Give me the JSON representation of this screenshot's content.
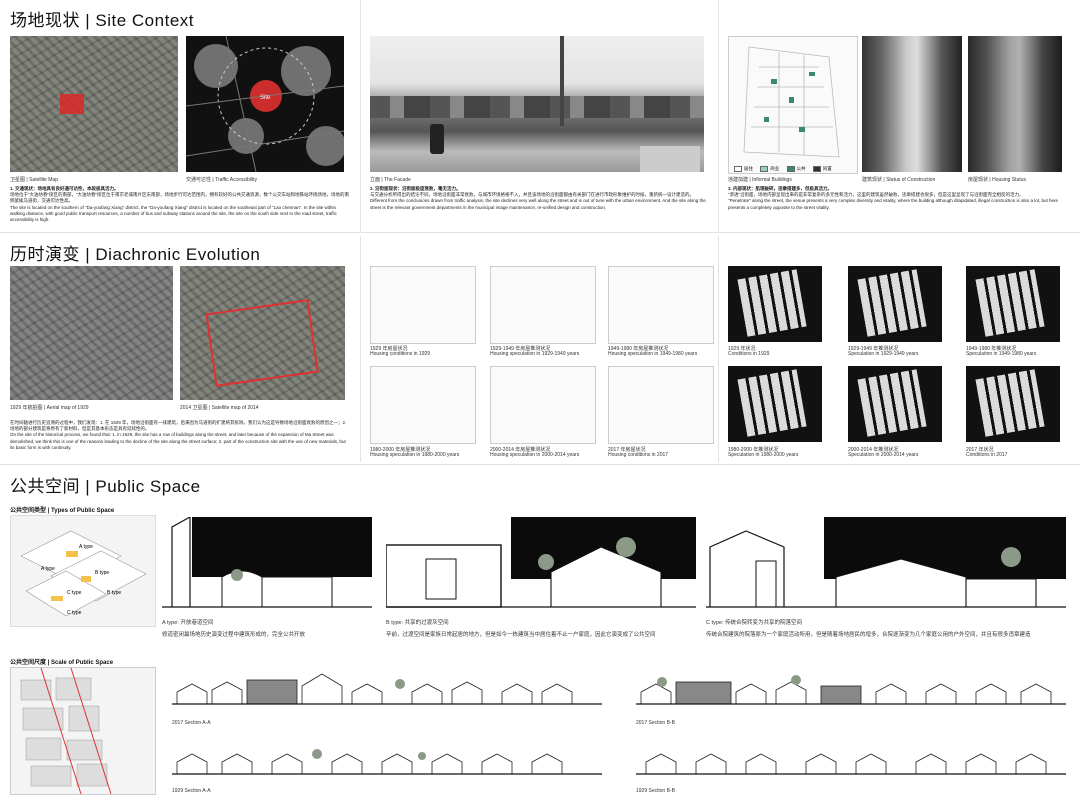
{
  "sections": {
    "site_context": {
      "cn": "场地现状",
      "sep": "|",
      "en": "Site Context"
    },
    "diachronic": {
      "cn": "历时演变",
      "sep": "|",
      "en": "Diachronic Evolution"
    },
    "public_space": {
      "cn": "公共空间",
      "sep": "|",
      "en": "Public Space"
    }
  },
  "site": {
    "cap_satellite": "卫星图 | Satellite Map",
    "cap_traffic": "交通可达性 | Traffic Accessibility",
    "site_label": "Site",
    "p1_title": "1. 交通现状：场地具有良好通可达性，本段极具活力。",
    "p1_cn": "场地位于“大油坊巷”街区的南部，“大油坊巷”街区位于南京老城南片区东南部，场地步行可达范围内，拥有较好的公共交通资源，数个公交车站和地铁站环绕场地，场地的南侧紧挨马道街，交通可达性高。",
    "p1_en": "The site is located on the southern of \"Da-youfang Xiang\" district, the \"Da-youfang Xiang\" district is located on the southeast part of \"Lao chennan\". In the site within walking distance, with good public transport resources, a number of bus and subway stations around the site, the site on the south side next to the road street, traffic accessibility is high.",
    "cap_facade": "立面 | The Facade",
    "p2_title": "2. 沿街面现状：沿街面极度衰败，毫无活力。",
    "p2_cn": "与交通分析所得出的结论不同，场地沿街面非常衰败，与城市环境格格不入。并且该场地的沿街面都由有关部门在进行市政形象维护的时候，重新统一设计建造的。",
    "p2_en": "Different from the conclusions drawn from traffic analysis, the site declines very well along the street and is out of tune with the urban environment. And the site along the street is the relevant government departments in the municipal image maintenance, re-unified design and construction.",
    "legend": [
      "居住",
      "商业",
      "公共",
      "闲置"
    ],
    "cap_informal": "违建加建 | Informal Buildings",
    "cap_construction": "建筑现状 | Status of Construction",
    "cap_housing": "房屋现状 | Housing Status",
    "p3_title": "3. 内部现状：肌理破碎，违章搭建多，但极具活力。",
    "p3_cn": "“渗透”沿街面，场地内部呈现出来的是非常复杂的多元性和活力，这里的建筑虽然破败，违章搭建也很多，但是这里呈现了与沿街面完全相反的活力。",
    "p3_en": "\"Penetrate\" along the street, the venue presents a very complex diversity and vitality, where the building although dilapidated, illegal construction is also a lot, but here presents a completely opposite to the street vitality."
  },
  "diachronic": {
    "cap_aerial": "1929 年航拍图 | Aerial map of 1929",
    "cap_sat2014": "2014 卫星图 | Satellite map of 2014",
    "para_cn": "在时间轴进行历史追溯的过程中，我们发现：1. 在 1929 年，场地沿街面有一排建筑，后来因为马道街的扩建将其拆除，我们认为这是导致场地沿街面衰败的原因之一；2. 场地的部分建筑是将原有了新材料，但是其基本形态是具有延续性的。",
    "para_en": "On the site of the historical process, we found that: 1. in 1929, the site has a row of buildings along the street, and later because of the expansion of Ma Street was demolished, we think this is one of the reasons leading to the decline of the site along the street surface; 2. part of the construction site with the use of new materials, but its basic form is with continuity.",
    "housing": [
      {
        "cn": "1929 年房屋状况",
        "en": "Housing conditions in 1929"
      },
      {
        "cn": "1929-1949 年房屋推测状况",
        "en": "Housing speculation in 1929-1949 years"
      },
      {
        "cn": "1949-1980 年房屋推测状况",
        "en": "Housing speculation in 1949-1980 years"
      },
      {
        "cn": "1980-2000 年房屋推测状况",
        "en": "Housing speculation in 1980-2000 years"
      },
      {
        "cn": "2000-2014 年房屋推测状况",
        "en": "Housing speculation in 2000-2014 years"
      },
      {
        "cn": "2017 年房屋状况",
        "en": "Housing conditions in 2017"
      }
    ],
    "fg": [
      {
        "cn": "1929 年状况",
        "en": "Conditions in 1929"
      },
      {
        "cn": "1929-1949 年推测状况",
        "en": "Speculation in 1929-1949 years"
      },
      {
        "cn": "1949-1980 年推测状况",
        "en": "Speculation in 1949-1980 years"
      },
      {
        "cn": "1980-2000 年推测状况",
        "en": "Speculation in 1980-2000 years"
      },
      {
        "cn": "2000-2014 年推测状况",
        "en": "Speculation in 2000-2014 years"
      },
      {
        "cn": "2017 年状况",
        "en": "Conditions in 2017"
      }
    ]
  },
  "public": {
    "types_title": "公共空间类型 | Types of Public Space",
    "type_tags": [
      "A type",
      "B type",
      "C type",
      "A type",
      "B type",
      "C type"
    ],
    "a_cap": "A type: 开放巷道空间",
    "a_desc": "修道密闭最场地历史演变过程中建筑形成的，完全公共开放",
    "b_cap": "B type: 共享的过渡灰空间",
    "b_desc": "辛前，过渡空间是家族日常起居的地方，但是如今一栋建筑当中居住着不止一户家庭，因此它演变成了公共空间",
    "c_cap": "C type: 传统合院转变为共享的院落空间",
    "c_desc": "传统合院建筑的院落原为一个家庭活动所用，但是随着场地居民的增多，合院逐渐变为几个家庭公用的户外空间，并且有很多违章建造",
    "scale_title": "公共空间尺度 | Scale of Public Space",
    "sec_a1": "2017  Section A-A",
    "sec_b1": "2017  Section B-B",
    "sec_a2": "1929  Section A-A",
    "sec_b2": "1929  Section B-B"
  }
}
